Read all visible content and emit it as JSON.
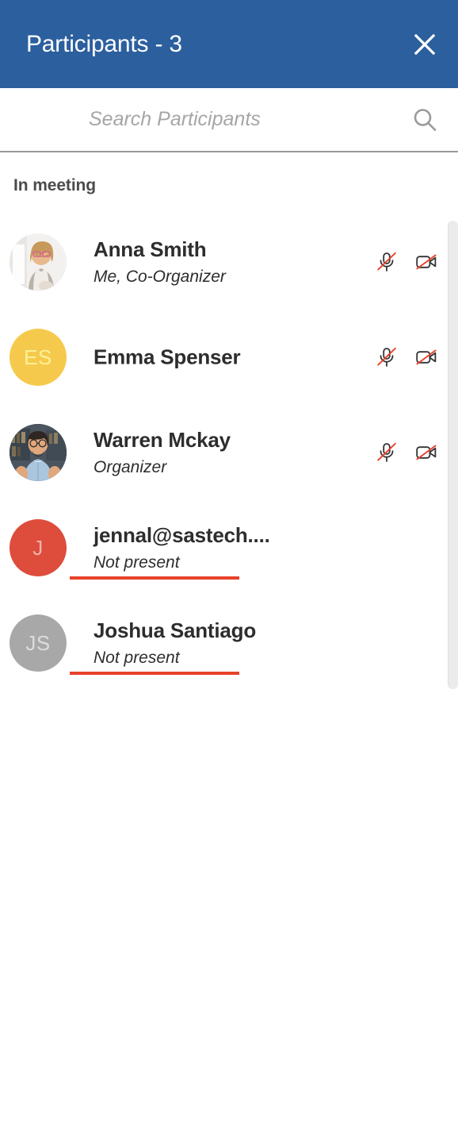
{
  "header": {
    "title": "Participants - 3",
    "close_label": "Close",
    "background_color": "#2b5f9e",
    "text_color": "#ffffff"
  },
  "search": {
    "placeholder": "Search Participants",
    "value": "",
    "icon": "search-icon"
  },
  "section": {
    "label": "In meeting"
  },
  "participants": [
    {
      "name": "Anna Smith",
      "subtitle": "Me, Co-Organizer",
      "avatar_type": "photo",
      "avatar_photo": "woman-blonde-glasses",
      "initials": "",
      "avatar_bg": "#f2f0ee",
      "initials_color": "",
      "mic": "muted",
      "camera": "off",
      "has_controls": true,
      "subtitle_underlined": false
    },
    {
      "name": "Emma Spenser",
      "subtitle": "",
      "avatar_type": "initials",
      "avatar_photo": "",
      "initials": "ES",
      "avatar_bg": "#f5ca4c",
      "initials_color": "#fdf09a",
      "mic": "muted",
      "camera": "off",
      "has_controls": true,
      "subtitle_underlined": false
    },
    {
      "name": "Warren Mckay",
      "subtitle": "Organizer",
      "avatar_type": "photo",
      "avatar_photo": "man-beard-glasses-blue-shirt",
      "initials": "",
      "avatar_bg": "#3c4650",
      "initials_color": "",
      "mic": "muted",
      "camera": "off",
      "has_controls": true,
      "subtitle_underlined": false
    },
    {
      "name": "jennal@sastech....",
      "subtitle": "Not present",
      "avatar_type": "initials",
      "avatar_photo": "",
      "initials": "J",
      "avatar_bg": "#de4c3c",
      "initials_color": "#f0b2ab",
      "mic": "",
      "camera": "",
      "has_controls": false,
      "subtitle_underlined": true
    },
    {
      "name": "Joshua Santiago",
      "subtitle": "Not present",
      "avatar_type": "initials",
      "avatar_photo": "",
      "initials": "JS",
      "avatar_bg": "#a8a8a8",
      "initials_color": "#dcdcdc",
      "mic": "",
      "camera": "",
      "has_controls": false,
      "subtitle_underlined": true
    }
  ],
  "annotation": {
    "underline_color": "#e8412a"
  },
  "scrollbar": {
    "thumb_color": "#ebebeb"
  }
}
